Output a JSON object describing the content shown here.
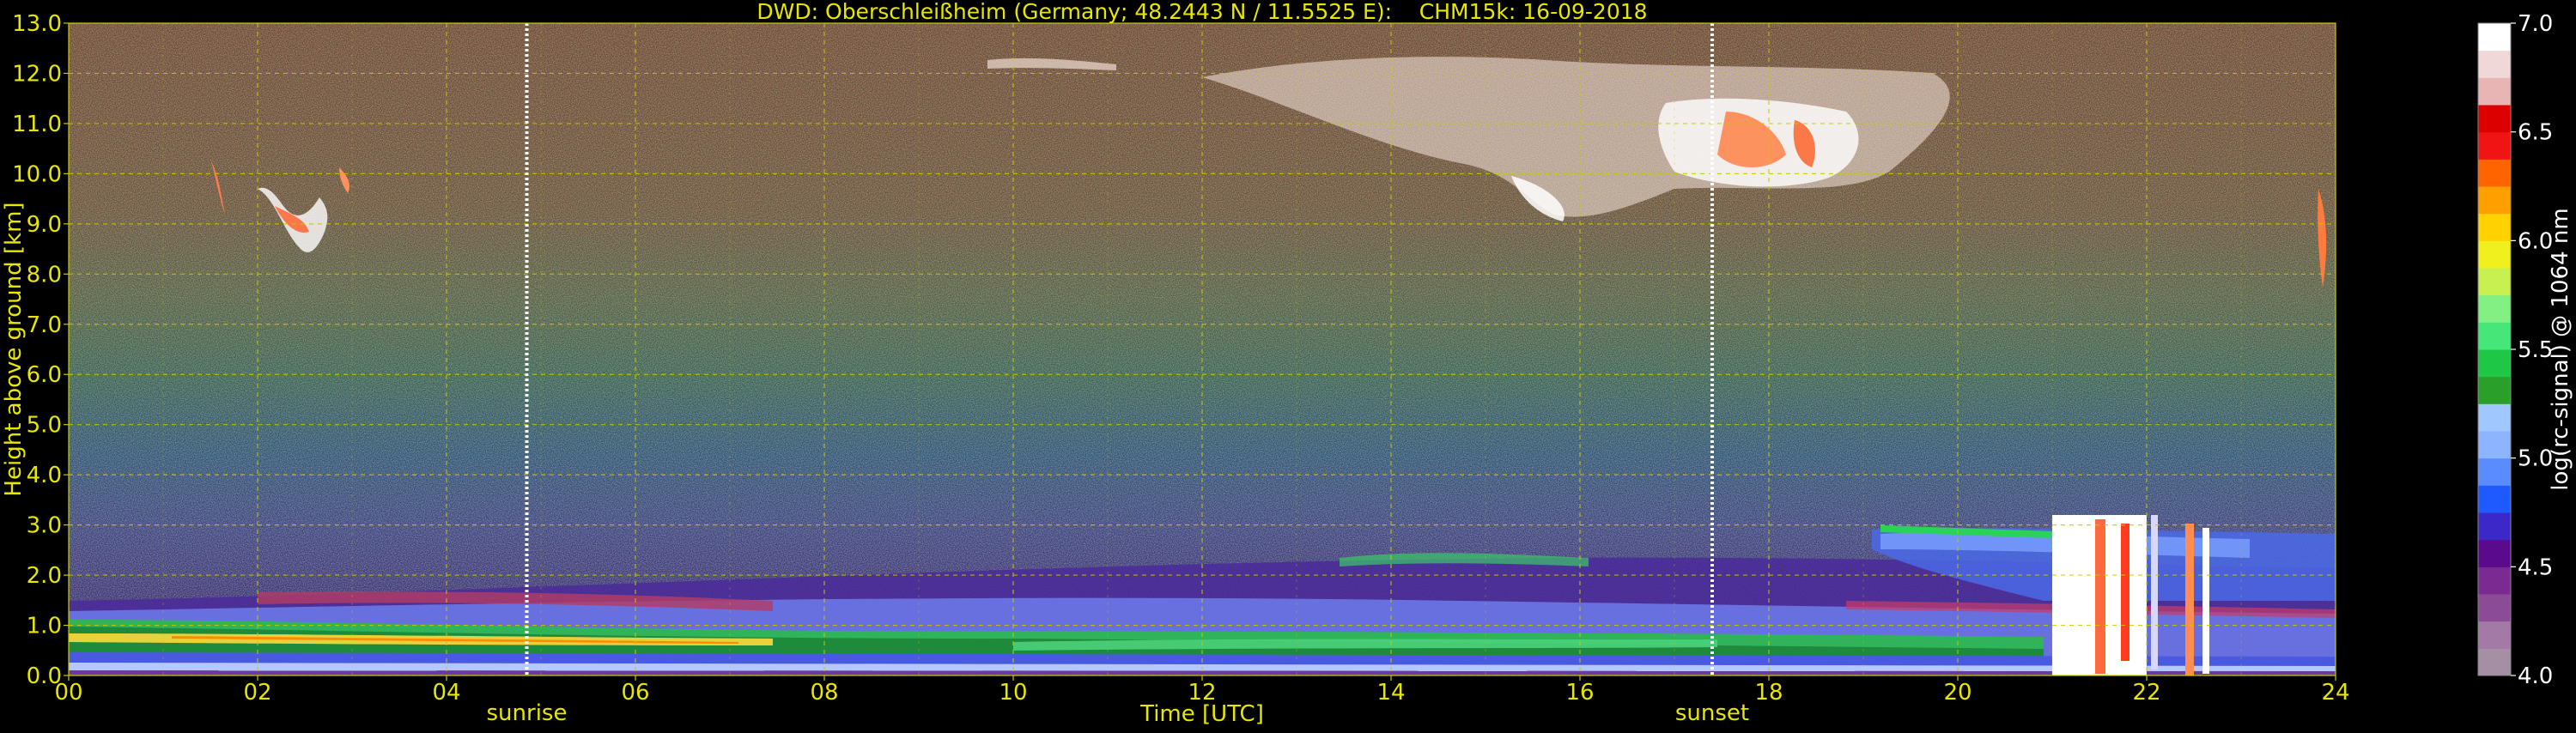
{
  "chart_data": {
    "type": "heatmap",
    "title": "DWD: Oberschleißheim (Germany; 48.2443 N / 11.5525 E):    CHM15k: 16-09-2018",
    "xlabel": "Time [UTC]",
    "ylabel": "Height above ground [km]",
    "x_ticks": [
      "00",
      "02",
      "04",
      "06",
      "08",
      "10",
      "12",
      "14",
      "16",
      "18",
      "20",
      "22",
      "24"
    ],
    "y_ticks": [
      "0.0",
      "1.0",
      "2.0",
      "3.0",
      "4.0",
      "5.0",
      "6.0",
      "7.0",
      "8.0",
      "9.0",
      "10.0",
      "11.0",
      "12.0",
      "13.0"
    ],
    "xlim": [
      0,
      24
    ],
    "ylim": [
      0,
      13
    ],
    "grid": true,
    "markers": [
      {
        "label": "sunrise",
        "time_utc": 4.85
      },
      {
        "label": "sunset",
        "time_utc": 17.4
      }
    ],
    "colorbar": {
      "label": "log(rc-signal) @ 1064 nm",
      "range": [
        4.0,
        7.0
      ],
      "ticks": [
        "4.0",
        "4.5",
        "5.0",
        "5.5",
        "6.0",
        "6.5",
        "7.0"
      ],
      "colors": [
        "#a58fa5",
        "#a27aa5",
        "#8c4b96",
        "#7a2a90",
        "#5a0a8c",
        "#3c28c8",
        "#1e5aff",
        "#5a8cff",
        "#8cb4ff",
        "#a0c8ff",
        "#2aa02a",
        "#1ec846",
        "#46e678",
        "#82f082",
        "#c8f050",
        "#f0f01e",
        "#ffd200",
        "#ffa000",
        "#ff6400",
        "#f01414",
        "#dc0000",
        "#e8b4b4",
        "#f0d8d8",
        "#ffffff"
      ]
    },
    "grid_color": "#c8c800",
    "text_color": "#e6e600"
  }
}
